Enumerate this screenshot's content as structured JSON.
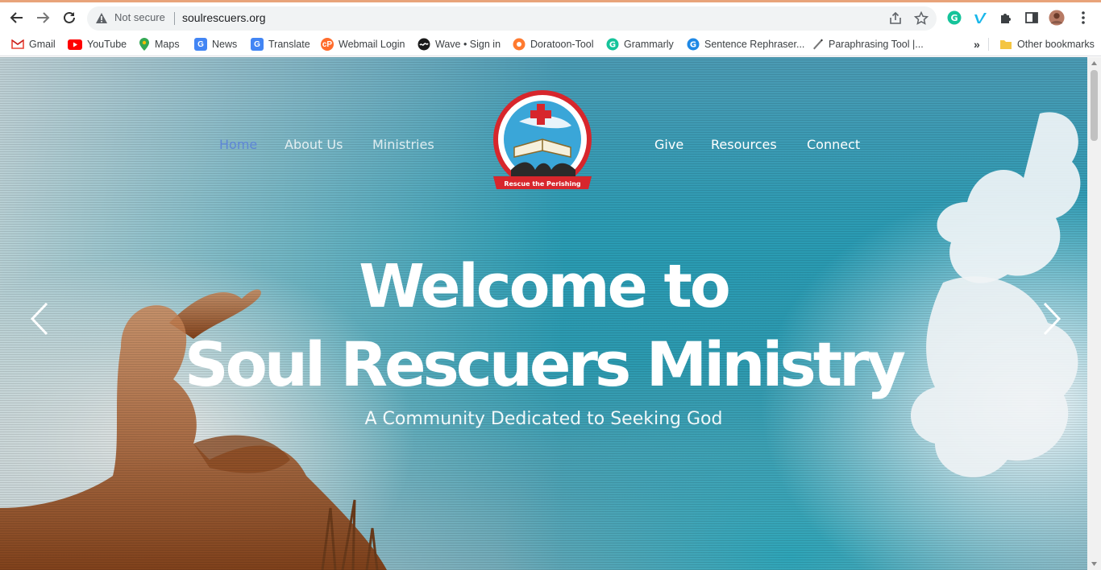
{
  "browser": {
    "security_label": "Not secure",
    "url": "soulrescuers.org"
  },
  "bookmarks": [
    {
      "label": "Gmail",
      "icon": "gmail-icon"
    },
    {
      "label": "YouTube",
      "icon": "youtube-icon"
    },
    {
      "label": "Maps",
      "icon": "maps-icon"
    },
    {
      "label": "News",
      "icon": "news-icon"
    },
    {
      "label": "Translate",
      "icon": "translate-icon"
    },
    {
      "label": "Webmail Login",
      "icon": "webmail-icon"
    },
    {
      "label": "Wave • Sign in",
      "icon": "wave-icon"
    },
    {
      "label": "Doratoon-Tool",
      "icon": "doratoon-icon"
    },
    {
      "label": "Grammarly",
      "icon": "grammarly-icon"
    },
    {
      "label": "Sentence Rephraser...",
      "icon": "rephraser-icon"
    },
    {
      "label": "Paraphrasing Tool |...",
      "icon": "paraphrasing-icon"
    }
  ],
  "bookmarks_overflow": "»",
  "other_bookmarks": "Other bookmarks",
  "site": {
    "nav_left": [
      "Home",
      "About Us",
      "Ministries"
    ],
    "nav_right": [
      "Give",
      "Resources",
      "Connect"
    ],
    "logo_text": "Rescue the Perishing",
    "headline_line1": "Welcome to",
    "headline_line2": "Soul Rescuers Ministry",
    "tagline": "A Community Dedicated to Seeking God"
  },
  "colors": {
    "active_nav": "#5e86d6",
    "hero_teal": "#2a9bb3",
    "logo_red": "#d7262c"
  }
}
